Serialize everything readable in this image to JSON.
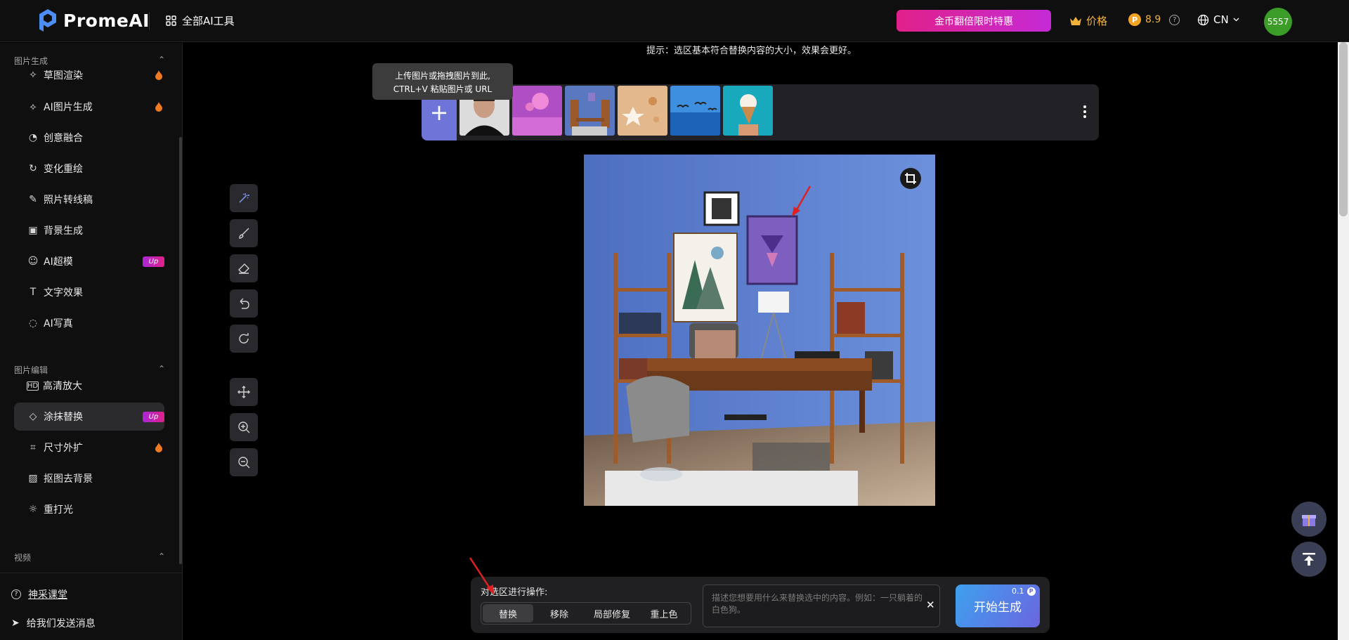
{
  "header": {
    "brand": "PromeAI",
    "all_tools": "全部AI工具",
    "promo": "金币翻倍限时特惠",
    "price": "价格",
    "credits": "8.9",
    "lang": "CN",
    "avatar": "5557"
  },
  "sidebar": {
    "section_image_gen": "图片生成",
    "image_gen_items": [
      {
        "label": "草图渲染",
        "icon": "sketch-render-icon",
        "badge": "fire"
      },
      {
        "label": "AI图片生成",
        "icon": "ai-image-icon",
        "badge": "fire"
      },
      {
        "label": "创意融合",
        "icon": "fusion-icon"
      },
      {
        "label": "变化重绘",
        "icon": "redraw-icon"
      },
      {
        "label": "照片转线稿",
        "icon": "line-art-icon"
      },
      {
        "label": "背景生成",
        "icon": "background-icon"
      },
      {
        "label": "AI超模",
        "icon": "model-icon",
        "badge": "Up"
      },
      {
        "label": "文字效果",
        "icon": "text-effect-icon"
      },
      {
        "label": "AI写真",
        "icon": "portrait-icon"
      }
    ],
    "section_image_edit": "图片编辑",
    "image_edit_items": [
      {
        "label": "高清放大",
        "icon": "hd-icon"
      },
      {
        "label": "涂抹替换",
        "icon": "eraser-icon",
        "badge": "Up",
        "active": true
      },
      {
        "label": "尺寸外扩",
        "icon": "crop-icon",
        "badge": "fire"
      },
      {
        "label": "抠图去背景",
        "icon": "cutout-icon"
      },
      {
        "label": "重打光",
        "icon": "relight-icon"
      }
    ],
    "section_video": "视频",
    "bottom": {
      "class_link": "神采课堂",
      "feedback": "给我们发送消息"
    }
  },
  "main": {
    "hint": "提示：选区基本符合替换内容的大小，效果会更好。",
    "tooltip_line1": "上传图片或拖拽图片到此,",
    "tooltip_line2": "CTRL+V 粘贴图片或 URL",
    "thumbnails": [
      "portrait",
      "pink-flowers",
      "office",
      "starfish",
      "birds-sea",
      "ice-cream"
    ],
    "tools": [
      "magic-select-icon",
      "brush-icon",
      "eraser-icon",
      "undo-icon",
      "reset-icon",
      "move-icon",
      "zoom-in-icon",
      "zoom-out-icon"
    ]
  },
  "bottom_panel": {
    "op_label": "对选区进行操作:",
    "modes": [
      "替换",
      "移除",
      "局部修复",
      "重上色"
    ],
    "active_mode": "替换",
    "prompt_placeholder": "描述您想要用什么来替换选中的内容。例如：一只躺着的白色狗。",
    "generate": "开始生成",
    "cost": "0.1"
  },
  "colors": {
    "accent": "#6e74d8",
    "promo_start": "#e0218a",
    "promo_end": "#c52ad6",
    "gold": "#f1b23b",
    "avatar": "#3b9d27"
  }
}
